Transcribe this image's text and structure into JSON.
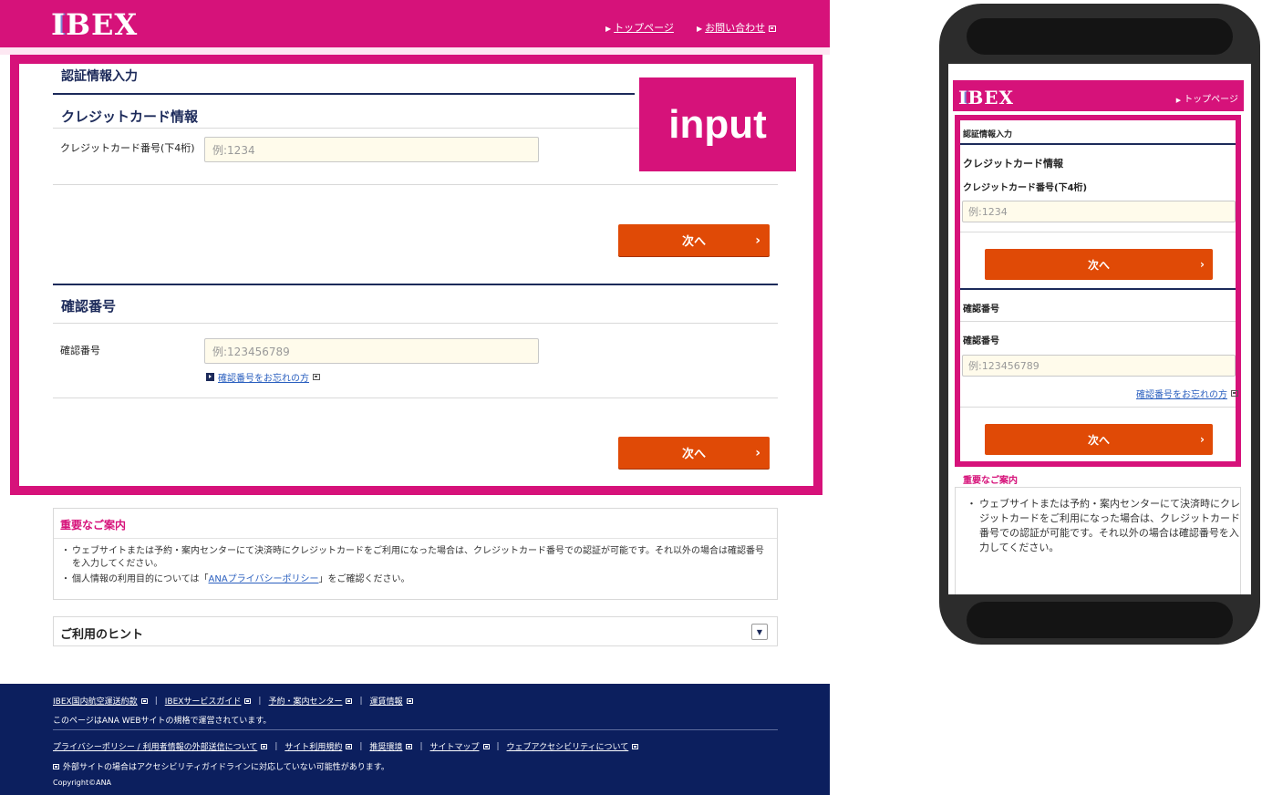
{
  "brand": {
    "logo_text": "IBEX",
    "accent_color": "#d6127a",
    "button_color": "#e04a06",
    "navy_color": "#1c2a5a"
  },
  "desktop": {
    "header": {
      "links": [
        "トップページ",
        "お問い合わせ"
      ]
    },
    "page_heading": "認証情報入力",
    "badge": "input",
    "credit_card": {
      "title": "クレジットカード情報",
      "field_label": "クレジットカード番号(下4桁)",
      "placeholder": "例:1234",
      "next_label": "次へ"
    },
    "confirmation": {
      "title": "確認番号",
      "field_label": "確認番号",
      "placeholder": "例:123456789",
      "help_link": "確認番号をお忘れの方",
      "next_label": "次へ"
    },
    "notice": {
      "title": "重要なご案内",
      "item1": "ウェブサイトまたは予約・案内センターにて決済時にクレジットカードをご利用になった場合は、クレジットカード番号での認証が可能です。それ以外の場合は確認番号を入力してください。",
      "item2_prefix": "個人情報の利用目的については「",
      "item2_link": "ANAプライバシーポリシー",
      "item2_suffix": "」をご確認ください。"
    },
    "hint": {
      "title": "ご利用のヒント"
    },
    "footer": {
      "row1": [
        "IBEX国内航空運送約款",
        "IBEXサービスガイド",
        "予約・案内センター",
        "運賃情報"
      ],
      "note1": "このページはANA WEBサイトの規格で運営されています。",
      "row2": [
        "プライバシーポリシー / 利用者情報の外部送信について",
        "サイト利用規約",
        "推奨環境",
        "サイトマップ",
        "ウェブアクセシビリティについて"
      ],
      "note2": "外部サイトの場合はアクセシビリティガイドラインに対応していない可能性があります。",
      "copyright": "Copyright©ANA"
    }
  },
  "mobile": {
    "header_link": "トップページ",
    "page_heading": "認証情報入力",
    "credit_card_title": "クレジットカード情報",
    "credit_card_label": "クレジットカード番号(下4桁)",
    "credit_card_placeholder": "例:1234",
    "next_label": "次へ",
    "confirmation_title": "確認番号",
    "confirmation_label": "確認番号",
    "confirmation_placeholder": "例:123456789",
    "help_link": "確認番号をお忘れの方",
    "notice_title": "重要なご案内",
    "notice_item": "ウェブサイトまたは予約・案内センターにて決済時にクレジットカードをご利用になった場合は、クレジットカード番号での認証が可能です。それ以外の場合は確認番号を入力してください。"
  }
}
